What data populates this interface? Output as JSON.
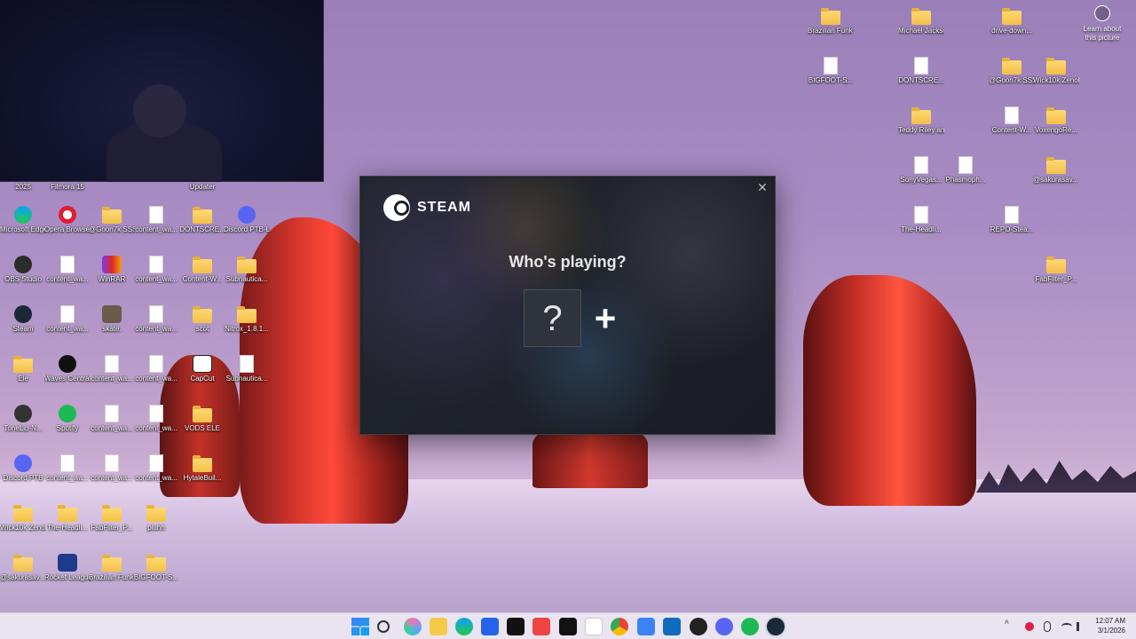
{
  "webcam": {},
  "desktop_left": [
    {
      "label": "2025"
    },
    {
      "label": "Filmora 15"
    },
    {
      "label": ""
    },
    {
      "label": ""
    },
    {
      "label": "Updater"
    },
    {
      "label": "Microsoft Edge"
    },
    {
      "label": "Opera Browser"
    },
    {
      "label": "@Goon7k SSSTEP#..."
    },
    {
      "label": "content_wa..."
    },
    {
      "label": "DONTSCRE..."
    },
    {
      "label": "Discord PTB-Laa-2"
    },
    {
      "label": "OBS Studio"
    },
    {
      "label": "content_wa..."
    },
    {
      "label": "WinRAR"
    },
    {
      "label": "content_wa..."
    },
    {
      "label": "Content-W..."
    },
    {
      "label": "Subnautica..."
    },
    {
      "label": "Steam"
    },
    {
      "label": "content_wa..."
    },
    {
      "label": "skate."
    },
    {
      "label": "content_wa..."
    },
    {
      "label": "scot"
    },
    {
      "label": "Nitrox_1.8.1..."
    },
    {
      "label": "Ele"
    },
    {
      "label": "Waves Central"
    },
    {
      "label": "content_wa..."
    },
    {
      "label": "content_wa..."
    },
    {
      "label": "CapCut"
    },
    {
      "label": "Subnautica..."
    },
    {
      "label": "ToneLib-N..."
    },
    {
      "label": "Spotify"
    },
    {
      "label": "content_wa..."
    },
    {
      "label": "content_wa..."
    },
    {
      "label": "VODS ELE"
    },
    {
      "label": "Discord PTB"
    },
    {
      "label": "content_wa..."
    },
    {
      "label": "content_wa..."
    },
    {
      "label": "content_wa..."
    },
    {
      "label": "HytaleBuil..."
    },
    {
      "label": "Wick10k Zenology ..."
    },
    {
      "label": "The-Headli..."
    },
    {
      "label": "FabFilter_P..."
    },
    {
      "label": "pluhh"
    },
    {
      "label": "@sakurasav... - GO GLO! ..."
    },
    {
      "label": "Rocket League®"
    },
    {
      "label": "Brazilian Funk Dru..."
    },
    {
      "label": "BIGFOOT-S..."
    }
  ],
  "desktop_right": [
    {
      "label": "Brazilian Funk Dru..."
    },
    {
      "label": "Michael Jackso..."
    },
    {
      "label": "drive-down..."
    },
    {
      "label": "BIGFOOT-S..."
    },
    {
      "label": "DONTSCRE..."
    },
    {
      "label": "@Goon7k SSSTEP#..."
    },
    {
      "label": "Wick10k Zenology ..."
    },
    {
      "label": "Teddy Riley and Micha..."
    },
    {
      "label": "Content-W..."
    },
    {
      "label": "VoxengoRe..."
    },
    {
      "label": "SonyVegas..."
    },
    {
      "label": "Phasmoph..."
    },
    {
      "label": "@sakurasav... - GO GLO! ..."
    },
    {
      "label": "The-Headli..."
    },
    {
      "label": "REPO-Stea..."
    },
    {
      "label": "FabFilter_P..."
    }
  ],
  "learn_about": "Learn about this picture",
  "steam_dialog": {
    "brand": "STEAM",
    "heading": "Who's playing?",
    "user_tile": "?",
    "add_tile": "+",
    "close": "✕"
  },
  "taskbar": {
    "time": "12:07 AM",
    "date": "3/1/2026",
    "tray": {
      "chevron": "^"
    }
  }
}
